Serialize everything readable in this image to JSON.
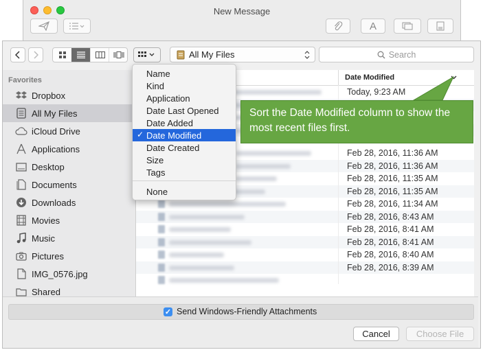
{
  "mail": {
    "title": "New Message",
    "format_button_label": "A"
  },
  "toolbar": {
    "location": "All My Files",
    "search_placeholder": "Search"
  },
  "sidebar": {
    "heading": "Favorites",
    "items": [
      {
        "label": "Dropbox",
        "icon": "dropbox-icon"
      },
      {
        "label": "All My Files",
        "icon": "all-files-icon",
        "selected": true
      },
      {
        "label": "iCloud Drive",
        "icon": "cloud-icon"
      },
      {
        "label": "Applications",
        "icon": "applications-icon"
      },
      {
        "label": "Desktop",
        "icon": "desktop-icon"
      },
      {
        "label": "Documents",
        "icon": "documents-icon"
      },
      {
        "label": "Downloads",
        "icon": "downloads-icon"
      },
      {
        "label": "Movies",
        "icon": "movies-icon"
      },
      {
        "label": "Music",
        "icon": "music-icon"
      },
      {
        "label": "Pictures",
        "icon": "pictures-icon"
      },
      {
        "label": "IMG_0576.jpg",
        "icon": "file-icon"
      },
      {
        "label": "Shared",
        "icon": "folder-icon"
      }
    ]
  },
  "file_list": {
    "column_date": "Date Modified",
    "dates": [
      "Today, 9:23 AM",
      "",
      "",
      "",
      "Feb 28, 2016, 11:36 AM",
      "Feb 28, 2016, 11:36 AM",
      "Feb 28, 2016, 11:35 AM",
      "Feb 28, 2016, 11:35 AM",
      "Feb 28, 2016, 11:34 AM",
      "Feb 28, 2016, 8:43 AM",
      "Feb 28, 2016, 8:41 AM",
      "Feb 28, 2016, 8:41 AM",
      "Feb 28, 2016, 8:40 AM",
      "Feb 28, 2016, 8:39 AM"
    ]
  },
  "arrange_menu": {
    "items": [
      "Name",
      "Kind",
      "Application",
      "Date Last Opened",
      "Date Added",
      "Date Modified",
      "Date Created",
      "Size",
      "Tags"
    ],
    "checked": "Date Modified",
    "none_label": "None"
  },
  "callout": {
    "text": "Sort the Date Modified column to show the most recent files first."
  },
  "footer": {
    "attachments_label": "Send Windows-Friendly Attachments",
    "cancel_label": "Cancel",
    "choose_label": "Choose File"
  },
  "colors": {
    "accent": "#2467dc",
    "callout": "#67a643",
    "checkbox": "#3c8ef0"
  }
}
